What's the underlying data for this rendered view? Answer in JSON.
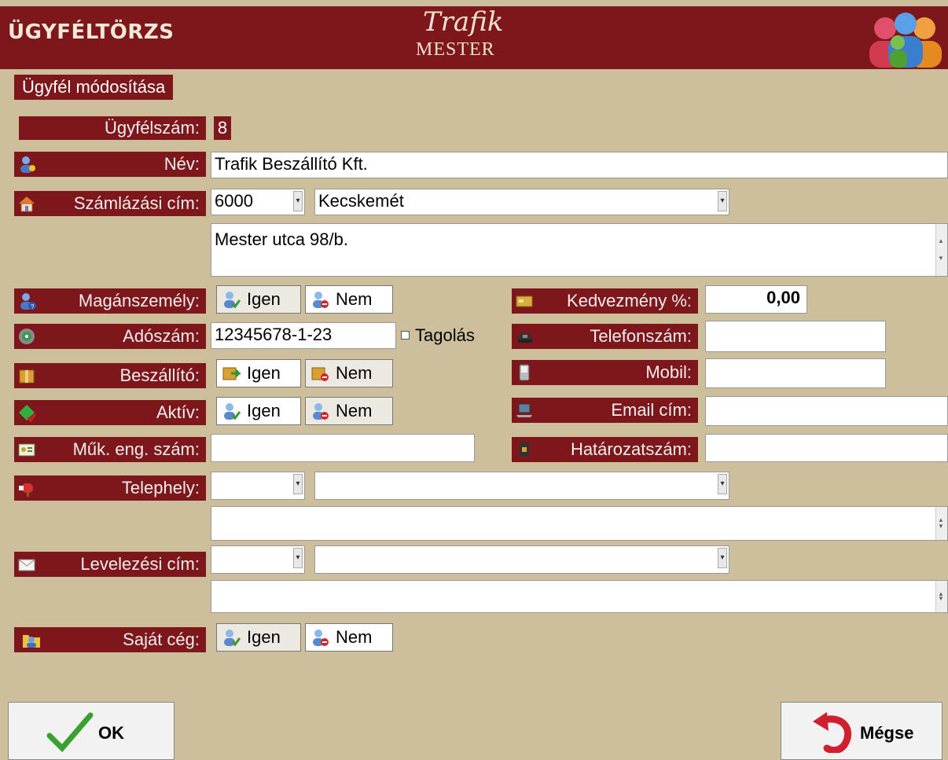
{
  "header": {
    "title": "ÜGYFÉLTÖRZS",
    "logo_script": "Trafik",
    "logo_sub": "MESTER"
  },
  "section_title": "Ügyfél módosítása",
  "labels": {
    "customer_no": "Ügyfélszám:",
    "name": "Név:",
    "billing_address": "Számlázási cím:",
    "private_person": "Magánszemély:",
    "tax_number": "Adószám:",
    "supplier": "Beszállító:",
    "active": "Aktív:",
    "license": "Műk. eng. szám:",
    "site": "Telephely:",
    "mailing_address": "Levelezési cím:",
    "own_company": "Saját cég:",
    "discount": "Kedvezmény %:",
    "phone": "Telefonszám:",
    "mobile": "Mobil:",
    "email": "Email cím:",
    "decision_no": "Határozatszám:"
  },
  "values": {
    "customer_no": "8",
    "name": "Trafik Beszállító Kft.",
    "billing_zip": "6000",
    "billing_city": "Kecskemét",
    "billing_street": "Mester utca 98/b.",
    "tax_number": "12345678-1-23",
    "segmentation_label": "Tagolás",
    "discount": "0,00",
    "phone": "",
    "mobile": "",
    "email": "",
    "license": "",
    "decision_no": "",
    "site_zip": "",
    "site_city": "",
    "site_street": "",
    "mail_zip": "",
    "mail_city": "",
    "mail_street": ""
  },
  "toggle": {
    "yes": "Igen",
    "no": "Nem"
  },
  "buttons": {
    "ok": "OK",
    "cancel": "Mégse"
  },
  "colors": {
    "header": "#7d171b",
    "background": "#cdbf9c"
  }
}
